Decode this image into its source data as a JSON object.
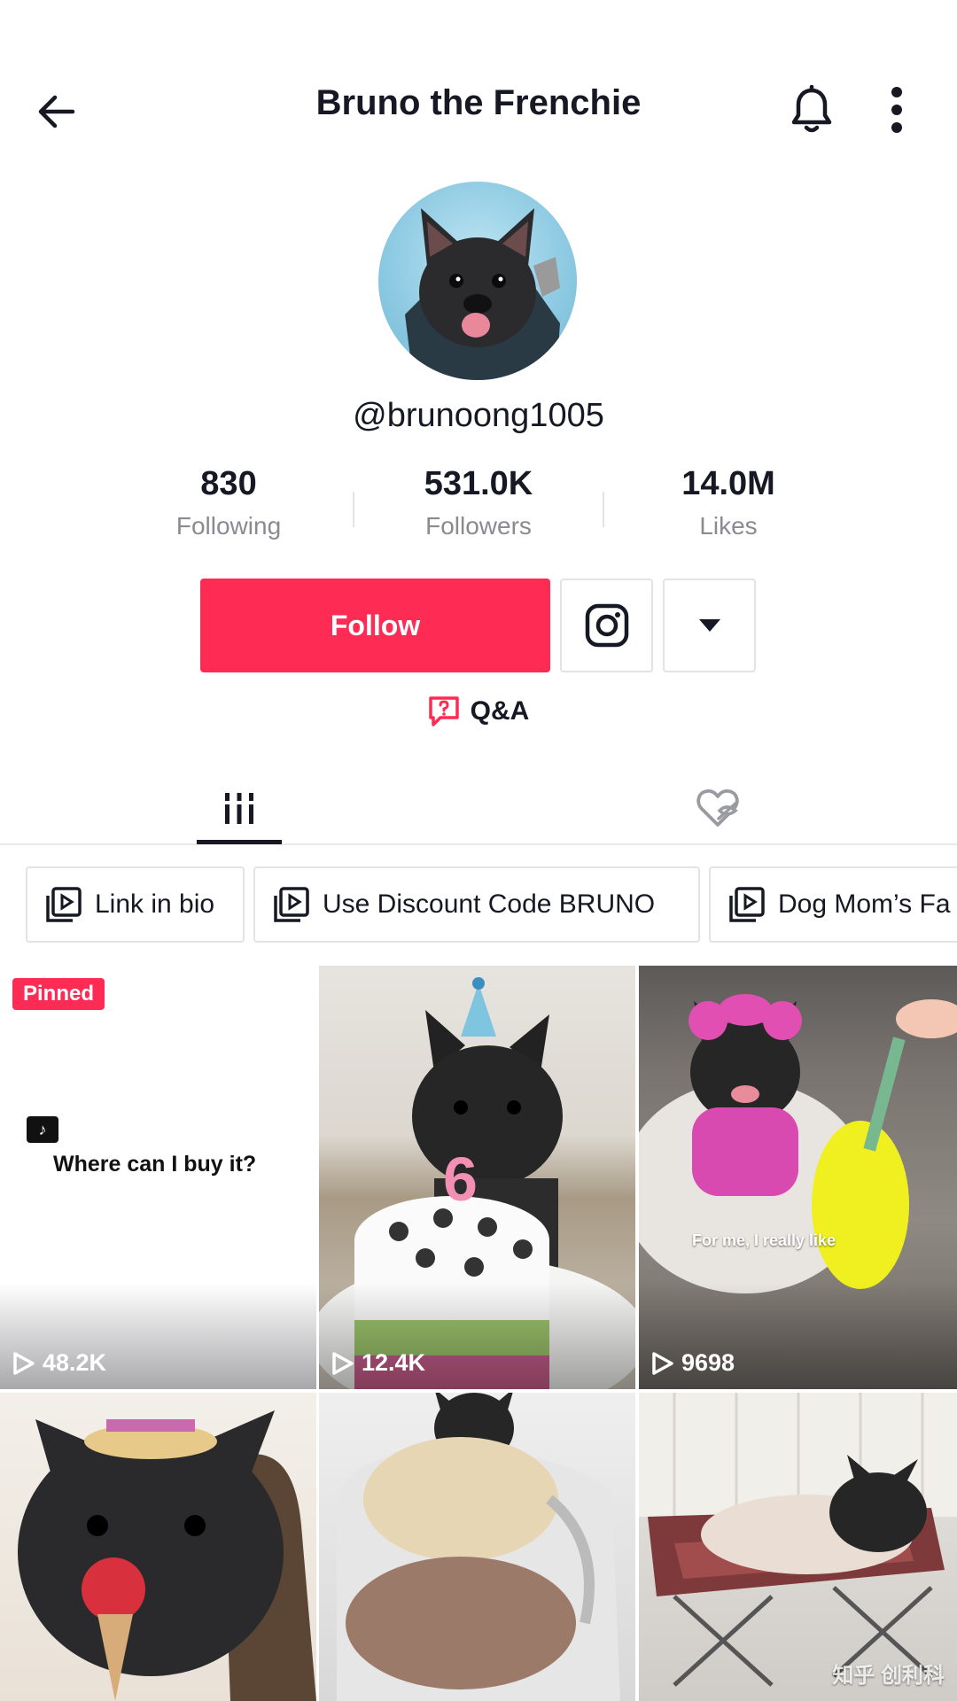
{
  "header": {
    "title": "Bruno the Frenchie",
    "back_icon": "arrow-left-icon",
    "bell_icon": "bell-icon",
    "more_icon": "more-vertical-icon"
  },
  "profile": {
    "username": "@brunoong1005",
    "avatar_icon": "frenchie-avatar"
  },
  "stats": [
    {
      "value": "830",
      "label": "Following"
    },
    {
      "value": "531.0K",
      "label": "Followers"
    },
    {
      "value": "14.0M",
      "label": "Likes"
    }
  ],
  "actions": {
    "follow_label": "Follow",
    "instagram_icon": "instagram-icon",
    "dropdown_icon": "caret-down-icon",
    "qa_label": "Q&A",
    "qa_icon": "question-bubble-icon"
  },
  "tabs": [
    {
      "name": "videos",
      "icon": "grid-icon",
      "active": true
    },
    {
      "name": "liked",
      "icon": "heart-hidden-icon",
      "active": false
    }
  ],
  "playlists": [
    {
      "label": "Link in bio"
    },
    {
      "label": "Use Discount Code BRUNO"
    },
    {
      "label": "Dog Mom’s Fa"
    }
  ],
  "videos": [
    {
      "views": "48.2K",
      "pinned": true,
      "pinned_label": "Pinned",
      "caption": "Where can I buy it?"
    },
    {
      "views": "12.4K"
    },
    {
      "views": "9698",
      "overlay": "For me, I really like"
    },
    {
      "views": ""
    },
    {
      "views": ""
    },
    {
      "views": "",
      "watermark": "知乎 创利科"
    }
  ],
  "colors": {
    "accent": "#fe2c55",
    "text": "#161823",
    "muted": "#8a8b91",
    "border": "#e3e3e4"
  }
}
